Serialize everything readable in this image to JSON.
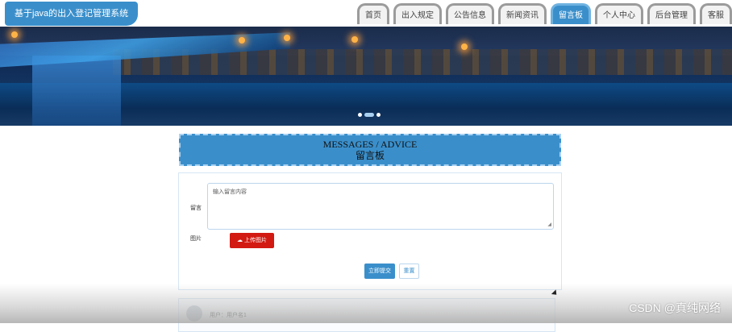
{
  "header": {
    "site_title": "基于java的出入登记管理系统",
    "nav": [
      {
        "label": "首页"
      },
      {
        "label": "出入规定"
      },
      {
        "label": "公告信息"
      },
      {
        "label": "新闻资讯"
      },
      {
        "label": "留言板",
        "active": true
      },
      {
        "label": "个人中心"
      },
      {
        "label": "后台管理"
      },
      {
        "label": "客服"
      }
    ]
  },
  "banner": {
    "slide_count": 3,
    "active_slide": 2
  },
  "section": {
    "title_en": "MESSAGES / ADVICE",
    "title_zh": "留言板"
  },
  "form": {
    "message_label": "留言",
    "message_placeholder": "输入留言内容",
    "image_label": "图片",
    "upload_label": "上传图片",
    "submit_label": "立即提交",
    "reset_label": "重置"
  },
  "comment": {
    "user_text": "用户：用户名1"
  },
  "watermark": "CSDN @真纯网络",
  "colors": {
    "accent": "#3a8fcb",
    "upload": "#d21a12"
  }
}
